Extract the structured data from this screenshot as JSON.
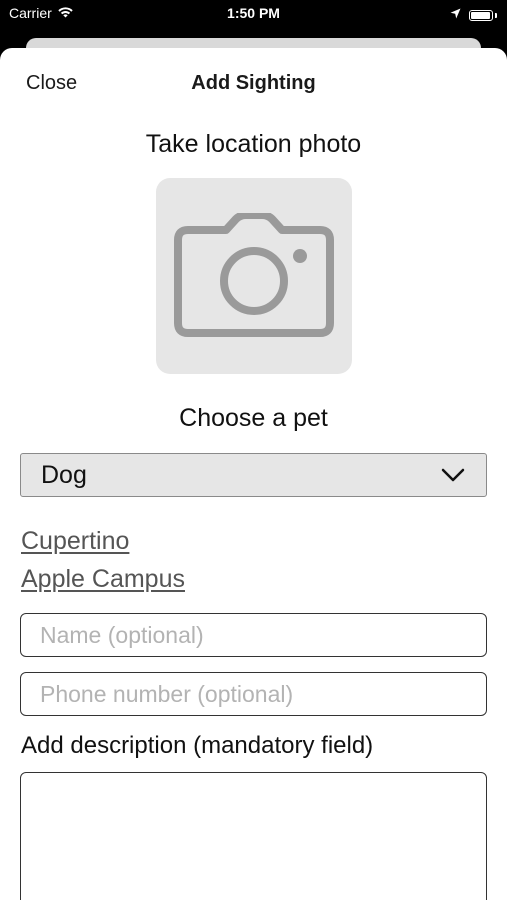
{
  "status_bar": {
    "carrier": "Carrier",
    "time": "1:50 PM",
    "battery_level": 0.95
  },
  "nav": {
    "close_label": "Close",
    "title": "Add Sighting"
  },
  "photo": {
    "title": "Take location photo",
    "icon": "camera-icon"
  },
  "pet": {
    "title": "Choose a pet",
    "selected": "Dog"
  },
  "location": {
    "city": "Cupertino",
    "place": "Apple Campus"
  },
  "form": {
    "name_placeholder": "Name (optional)",
    "phone_placeholder": "Phone number (optional)",
    "description_label": "Add description (mandatory field)"
  },
  "colors": {
    "sheet_background": "#ffffff",
    "field_background": "#e6e6e6",
    "link_color": "#555555"
  }
}
